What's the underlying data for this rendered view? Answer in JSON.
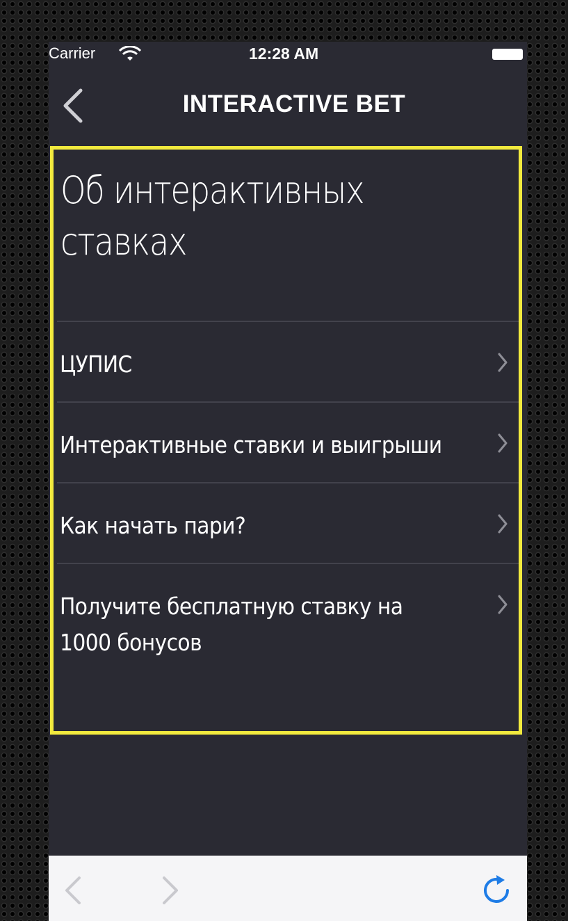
{
  "status_bar": {
    "carrier": "Carrier",
    "time": "12:28 AM",
    "wifi_icon": "wifi-icon",
    "battery_icon": "battery-icon"
  },
  "nav": {
    "title": "INTERACTIVE BET",
    "back_icon": "chevron-left-icon"
  },
  "content": {
    "title": "Об интерактивных ставках",
    "menu_items": [
      {
        "label": "ЦУПИС",
        "icon": "chevron-right-icon"
      },
      {
        "label": "Интерактивные ставки и выигрыши",
        "icon": "chevron-right-icon"
      },
      {
        "label": "Как начать пари?",
        "icon": "chevron-right-icon"
      },
      {
        "label": "Получите бесплатную ставку на 1000 бонусов",
        "icon": "chevron-right-icon"
      }
    ]
  },
  "toolbar": {
    "back_icon": "arrow-back-icon",
    "forward_icon": "arrow-forward-icon",
    "refresh_icon": "refresh-icon"
  },
  "colors": {
    "background": "#2a2a33",
    "highlight": "#f2ea3e",
    "divider": "#42424c",
    "toolbar": "#f5f5f7",
    "accent": "#1e7ce6"
  }
}
